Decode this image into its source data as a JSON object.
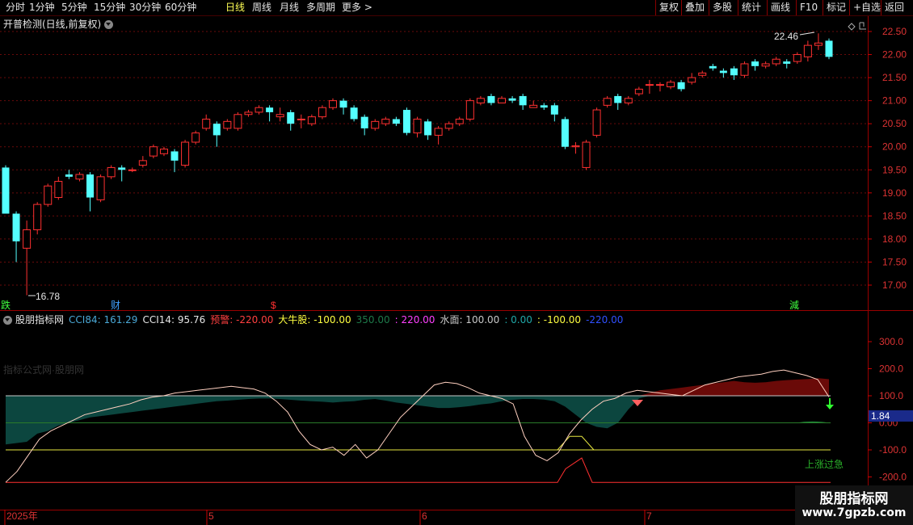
{
  "toolbar": {
    "periods": [
      "分时",
      "1分钟",
      "5分钟",
      "15分钟",
      "30分钟",
      "60分钟",
      "日线",
      "周线",
      "月线",
      "多周期",
      "更多"
    ],
    "active_period": "日线",
    "right_buttons": [
      "复权",
      "叠加",
      "多股",
      "统计",
      "画线",
      "F10",
      "标记",
      "+自选",
      "返回"
    ]
  },
  "stock_header": {
    "title": "开普检测(日线,前复权)"
  },
  "indicator_header": {
    "name": "股朋指标网",
    "items": [
      {
        "label": "CCI84: 161.29",
        "color": "#4aa8d6"
      },
      {
        "label": "CCI14: 95.76",
        "color": "#e6e6e6"
      },
      {
        "label": "预警: -220.00",
        "color": "#ff4040"
      },
      {
        "label": "大牛股: -100.00",
        "color": "#ffff40"
      },
      {
        "label": "350.00",
        "color": "#1e7a4a"
      },
      {
        "label": ": 220.00",
        "color": "#ff40ff"
      },
      {
        "label": "水面: 100.00",
        "color": "#c8c8c8"
      },
      {
        "label": ": 0.00",
        "color": "#20a8a8"
      },
      {
        "label": ": -100.00",
        "color": "#ffff40"
      },
      {
        "label": "-220.00",
        "color": "#3050ff"
      }
    ]
  },
  "price_axis": [
    "22.50",
    "22.00",
    "21.50",
    "21.00",
    "20.50",
    "20.00",
    "19.50",
    "19.00",
    "18.50",
    "18.00",
    "17.50",
    "17.00"
  ],
  "indicator_axis": [
    "300.0",
    "200.0",
    "100.0",
    "0.00",
    "-100.0",
    "-200.0"
  ],
  "annotations": {
    "high_label": "22.46",
    "low_label": "16.78",
    "marker_die": "跌",
    "marker_cai": "财",
    "marker_dollar": "$",
    "marker_jian": "減",
    "watermark_text": "指标公式网·股朋网",
    "rise_label": "上涨过急",
    "current_value": "1.84"
  },
  "date_axis": [
    "2025年",
    "5",
    "6",
    "7"
  ],
  "watermark": {
    "title": "股朋指标网",
    "url": "www.7gpzb.com"
  },
  "chart_data": {
    "type": "candlestick",
    "ylim": [
      16.6,
      22.8
    ],
    "candles": [
      [
        19.55,
        18.55,
        19.6,
        18.55
      ],
      [
        18.55,
        17.95,
        18.6,
        17.5
      ],
      [
        17.8,
        18.2,
        18.4,
        16.78
      ],
      [
        18.2,
        18.75,
        18.8,
        18.1
      ],
      [
        18.75,
        19.15,
        19.2,
        18.7
      ],
      [
        18.9,
        19.25,
        19.35,
        18.85
      ],
      [
        19.4,
        19.35,
        19.5,
        19.3
      ],
      [
        19.3,
        19.4,
        19.45,
        19.25
      ],
      [
        19.4,
        18.9,
        19.45,
        18.6
      ],
      [
        18.85,
        19.35,
        19.4,
        18.8
      ],
      [
        19.35,
        19.55,
        19.6,
        19.3
      ],
      [
        19.55,
        19.5,
        19.6,
        19.25
      ],
      [
        19.5,
        19.5,
        19.55,
        19.45
      ],
      [
        19.6,
        19.7,
        19.8,
        19.55
      ],
      [
        19.8,
        20.0,
        20.05,
        19.75
      ],
      [
        19.85,
        19.95,
        20.0,
        19.8
      ],
      [
        19.9,
        19.7,
        19.95,
        19.45
      ],
      [
        19.6,
        20.1,
        20.15,
        19.55
      ],
      [
        20.1,
        20.3,
        20.35,
        20.05
      ],
      [
        20.4,
        20.6,
        20.7,
        20.35
      ],
      [
        20.5,
        20.25,
        20.55,
        20.0
      ],
      [
        20.4,
        20.55,
        20.6,
        20.35
      ],
      [
        20.4,
        20.7,
        20.75,
        20.35
      ],
      [
        20.7,
        20.75,
        20.8,
        20.65
      ],
      [
        20.75,
        20.85,
        20.9,
        20.7
      ],
      [
        20.85,
        20.75,
        20.9,
        20.55
      ],
      [
        20.65,
        20.7,
        20.85,
        20.55
      ],
      [
        20.75,
        20.5,
        20.8,
        20.35
      ],
      [
        20.6,
        20.6,
        20.7,
        20.4
      ],
      [
        20.5,
        20.65,
        20.7,
        20.45
      ],
      [
        20.65,
        20.85,
        20.9,
        20.6
      ],
      [
        20.85,
        21.0,
        21.05,
        20.8
      ],
      [
        21.0,
        20.85,
        21.05,
        20.7
      ],
      [
        20.85,
        20.6,
        20.9,
        20.55
      ],
      [
        20.65,
        20.4,
        20.7,
        20.25
      ],
      [
        20.4,
        20.55,
        20.6,
        20.35
      ],
      [
        20.5,
        20.6,
        20.65,
        20.45
      ],
      [
        20.6,
        20.5,
        20.65,
        20.45
      ],
      [
        20.8,
        20.3,
        20.85,
        20.25
      ],
      [
        20.3,
        20.6,
        20.65,
        20.2
      ],
      [
        20.55,
        20.25,
        20.6,
        20.15
      ],
      [
        20.25,
        20.4,
        20.45,
        20.05
      ],
      [
        20.4,
        20.5,
        20.55,
        20.35
      ],
      [
        20.5,
        20.6,
        20.65,
        20.45
      ],
      [
        20.6,
        21.0,
        21.05,
        20.55
      ],
      [
        20.95,
        21.05,
        21.1,
        20.9
      ],
      [
        21.1,
        20.95,
        21.15,
        20.9
      ],
      [
        20.95,
        21.05,
        21.1,
        20.95
      ],
      [
        21.05,
        21.0,
        21.1,
        20.95
      ],
      [
        21.1,
        20.9,
        21.15,
        20.8
      ],
      [
        20.85,
        20.9,
        21.0,
        20.85
      ],
      [
        20.9,
        20.85,
        20.95,
        20.8
      ],
      [
        20.9,
        20.7,
        20.95,
        20.55
      ],
      [
        20.6,
        20.0,
        20.65,
        19.95
      ],
      [
        20.0,
        20.02,
        20.1,
        19.85
      ],
      [
        19.55,
        20.1,
        20.15,
        19.5
      ],
      [
        20.25,
        20.8,
        20.85,
        20.2
      ],
      [
        20.9,
        21.05,
        21.1,
        20.85
      ],
      [
        21.1,
        20.95,
        21.15,
        20.8
      ],
      [
        20.95,
        21.05,
        21.1,
        20.9
      ],
      [
        21.15,
        21.25,
        21.3,
        21.1
      ],
      [
        21.35,
        21.35,
        21.45,
        21.15
      ],
      [
        21.35,
        21.35,
        21.4,
        21.2
      ],
      [
        21.3,
        21.4,
        21.45,
        21.25
      ],
      [
        21.4,
        21.25,
        21.45,
        21.2
      ],
      [
        21.4,
        21.5,
        21.6,
        21.35
      ],
      [
        21.55,
        21.6,
        21.65,
        21.5
      ],
      [
        21.75,
        21.7,
        21.8,
        21.65
      ],
      [
        21.65,
        21.6,
        21.7,
        21.5
      ],
      [
        21.7,
        21.55,
        21.75,
        21.45
      ],
      [
        21.55,
        21.8,
        21.85,
        21.5
      ],
      [
        21.85,
        21.75,
        21.9,
        21.65
      ],
      [
        21.75,
        21.8,
        21.85,
        21.7
      ],
      [
        21.8,
        21.9,
        21.95,
        21.75
      ],
      [
        21.85,
        21.8,
        21.9,
        21.7
      ],
      [
        21.85,
        22.0,
        22.05,
        21.8
      ],
      [
        21.95,
        22.2,
        22.3,
        21.85
      ],
      [
        22.2,
        22.25,
        22.46,
        22.1
      ],
      [
        22.3,
        21.95,
        22.35,
        21.9
      ]
    ],
    "cci84": [
      -80,
      -75,
      -70,
      -40,
      -30,
      -10,
      0,
      10,
      20,
      25,
      30,
      35,
      40,
      45,
      50,
      55,
      60,
      65,
      70,
      75,
      80,
      82,
      85,
      88,
      90,
      90,
      88,
      85,
      82,
      80,
      78,
      75,
      78,
      80,
      85,
      88,
      82,
      75,
      70,
      65,
      60,
      55,
      55,
      58,
      62,
      68,
      72,
      80,
      85,
      88,
      88,
      86,
      80,
      60,
      30,
      0,
      -15,
      -20,
      0,
      50,
      90,
      110,
      120,
      125,
      130,
      135,
      140,
      145,
      150,
      155,
      150,
      148,
      150,
      155,
      158,
      160,
      162,
      165,
      161.29
    ],
    "cci14": [
      -220,
      -180,
      -120,
      -60,
      -30,
      -10,
      10,
      30,
      40,
      50,
      60,
      70,
      85,
      95,
      100,
      110,
      115,
      120,
      125,
      130,
      135,
      130,
      125,
      110,
      80,
      40,
      -30,
      -80,
      -100,
      -90,
      -120,
      -80,
      -130,
      -100,
      -40,
      20,
      60,
      100,
      140,
      150,
      145,
      130,
      110,
      100,
      90,
      70,
      -50,
      -120,
      -140,
      -110,
      -40,
      10,
      50,
      80,
      90,
      110,
      120,
      115,
      110,
      105,
      100,
      120,
      140,
      150,
      160,
      170,
      175,
      180,
      190,
      195,
      185,
      175,
      160,
      95.76
    ],
    "water": 100,
    "zero": 0,
    "neg100": -100,
    "neg220": -220
  }
}
